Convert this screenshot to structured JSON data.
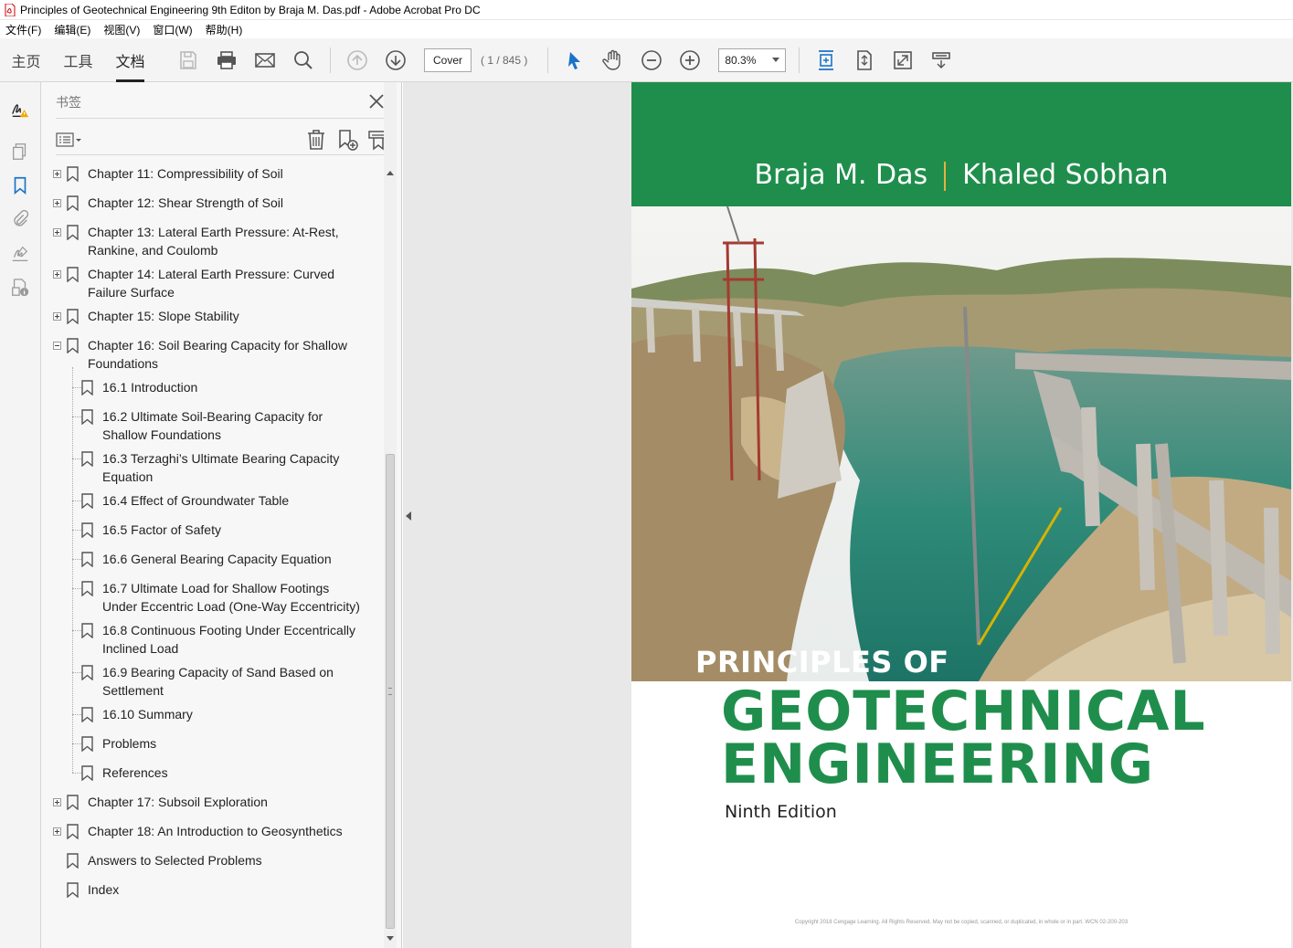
{
  "window": {
    "title": "Principles of Geotechnical Engineering  9th Editon by Braja M. Das.pdf - Adobe Acrobat Pro DC"
  },
  "menu": [
    "文件(F)",
    "编辑(E)",
    "视图(V)",
    "窗口(W)",
    "帮助(H)"
  ],
  "toolbar": {
    "tabs": [
      "主页",
      "工具",
      "文档"
    ],
    "active_tab": "文档",
    "page_input": "Cover",
    "page_count": "( 1 / 845 )",
    "zoom": "80.3%"
  },
  "bookmarks_panel": {
    "title": "书签",
    "items": [
      {
        "label": "Chapter 11: Compressibility of Soil",
        "level": 0,
        "expander": "plus"
      },
      {
        "label": "Chapter 12: Shear Strength of Soil",
        "level": 0,
        "expander": "plus"
      },
      {
        "label": "Chapter 13: Lateral Earth Pressure: At-Rest,",
        "label2": "Rankine,  and Coulomb",
        "level": 0,
        "expander": "plus"
      },
      {
        "label": "Chapter 14: Lateral Earth Pressure: Curved",
        "label2": "Failure Surface",
        "level": 0,
        "expander": "plus"
      },
      {
        "label": "Chapter 15: Slope Stability",
        "level": 0,
        "expander": "plus"
      },
      {
        "label": "Chapter 16: Soil Bearing Capacity for Shallow",
        "label2": "Foundations",
        "level": 0,
        "expander": "minus"
      },
      {
        "label": "16.1 Introduction",
        "level": 1
      },
      {
        "label": "16.2 Ultimate Soil-Bearing Capacity for",
        "label2": "Shallow Foundations",
        "level": 1
      },
      {
        "label": "16.3 Terzaghi’s Ultimate Bearing Capacity",
        "label2": "Equation",
        "level": 1
      },
      {
        "label": "16.4 Effect of Groundwater Table",
        "level": 1
      },
      {
        "label": "16.5 Factor of Safety",
        "level": 1
      },
      {
        "label": "16.6 General Bearing Capacity Equation",
        "level": 1
      },
      {
        "label": "16.7 Ultimate Load for Shallow Footings",
        "label2": "Under Eccentric Load (One-Way Eccentricity)",
        "level": 1
      },
      {
        "label": "16.8 Continuous Footing Under Eccentrically",
        "label2": "Inclined Load",
        "level": 1
      },
      {
        "label": "16.9 Bearing Capacity of Sand Based on",
        "label2": "Settlement",
        "level": 1
      },
      {
        "label": "16.10 Summary",
        "level": 1
      },
      {
        "label": "Problems",
        "level": 1
      },
      {
        "label": "References",
        "level": 1
      },
      {
        "label": "Chapter 17: Subsoil Exploration",
        "level": 0,
        "expander": "plus"
      },
      {
        "label": "Chapter 18: An Introduction to Geosynthetics",
        "level": 0,
        "expander": "plus"
      },
      {
        "label": "Answers to Selected Problems",
        "level": 0
      },
      {
        "label": "Index",
        "level": 0
      }
    ]
  },
  "cover": {
    "author1": "Braja M. Das",
    "author2": "Khaled Sobhan",
    "title_pre": "PRINCIPLES OF",
    "title_line1": "GEOTECHNICAL",
    "title_line2": "ENGINEERING",
    "edition": "Ninth Edition",
    "copyright": "Copyright 2018 Cengage Learning. All Rights Reserved. May not be copied, scanned, or duplicated, in whole or in part.  WCN 02-200-203",
    "colors": {
      "band": "#1f8e4c",
      "title": "#1f8e4c",
      "divider": "#e6b33c"
    }
  }
}
